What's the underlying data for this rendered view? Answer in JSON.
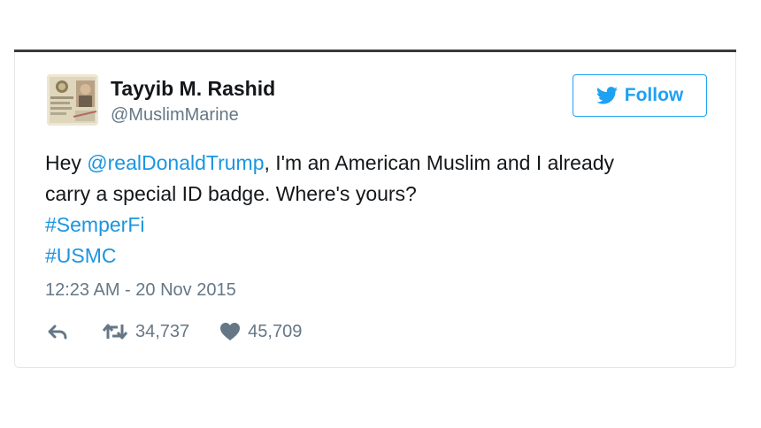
{
  "colors": {
    "accent": "#1da1f2",
    "link": "#1b95e0",
    "text": "#14171a",
    "muted": "#657786",
    "card_border": "#e3e7ea"
  },
  "user": {
    "display_name": "Tayyib M. Rashid",
    "handle": "@MuslimMarine",
    "avatar_icon": "id-badge-photo"
  },
  "follow_button": {
    "icon": "twitter-bird-icon",
    "label": "Follow"
  },
  "tweet": {
    "line1_prefix": "Hey ",
    "mention": "@realDonaldTrump",
    "line1_suffix": ", I'm an American Muslim and I already",
    "line2": "carry a special ID badge. Where's yours?",
    "hashtags": [
      "#SemperFi",
      "#USMC"
    ],
    "timestamp": "12:23 AM - 20 Nov 2015"
  },
  "actions": {
    "reply_icon": "reply-icon",
    "retweet_icon": "retweet-icon",
    "retweet_count": "34,737",
    "like_icon": "heart-icon",
    "like_count": "45,709"
  }
}
